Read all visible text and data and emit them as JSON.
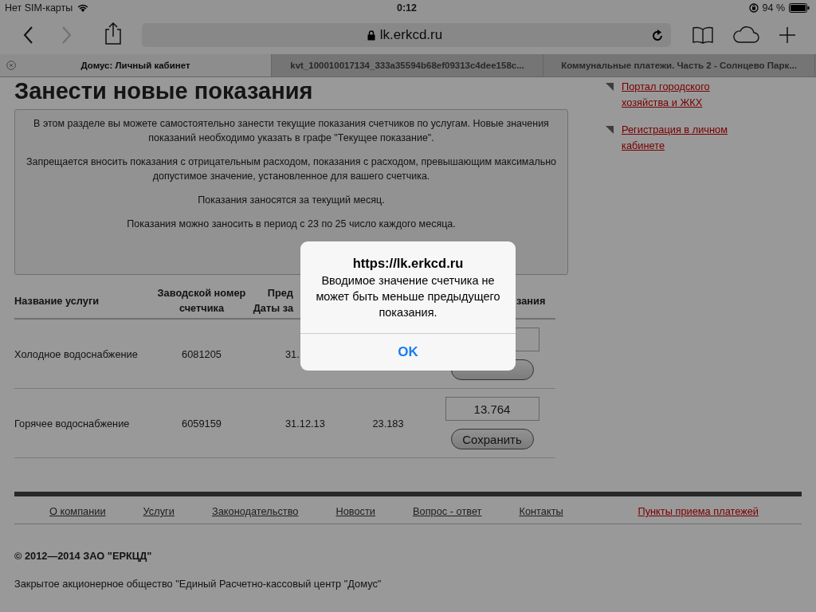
{
  "status_bar": {
    "carrier": "Нет SIM-карты",
    "time": "0:12",
    "battery": "94 %"
  },
  "toolbar": {
    "back": {
      "disabled": false
    },
    "forward": {
      "disabled": true
    },
    "address": "lk.erkcd.ru"
  },
  "tabs": [
    {
      "label": "Домус: Личный кабинет",
      "selected": true
    },
    {
      "label": "kvt_100010017134_333a35594b68ef09313c4dee158c...",
      "selected": false
    },
    {
      "label": "Коммунальные платежи. Часть 2 - Солнцево Парк...",
      "selected": false
    }
  ],
  "page": {
    "heading": "Занести новые показания",
    "notice": [
      "В этом разделе вы можете самостоятельно занести текущие показания счетчиков по услугам. Новые значения показаний необходимо указать в графе \"Текущее показание\".",
      "Запрещается вносить показания с отрицательным расходом, показания с расходом, превышающим максимально допустимое значение, установленное для вашего счетчика.",
      "Показания заносятся за текущий месяц.",
      "Показания можно заносить в период с 23 по 25 число каждого месяца."
    ],
    "table": {
      "header": {
        "column_1": [
          "Название услуги"
        ],
        "column_2": [
          "Заводской номер",
          "счетчика"
        ],
        "column_3": [
          "Пред",
          "Даты за"
        ],
        "column_5": [
          "зания"
        ]
      },
      "rows": [
        {
          "service": "Холодное водоснабжение",
          "serial": "6081205",
          "date": "31."
        },
        {
          "service": "Горячее водоснабжение",
          "serial": "6059159",
          "date": "31.12.13",
          "previous": "23.183",
          "current": "13.764",
          "save": "Сохранить"
        }
      ]
    },
    "sidebar_links": [
      "Портал городского хозяйства и ЖКХ",
      "Регистрация в личном кабинете"
    ],
    "footer": {
      "links": [
        {
          "label": "О компании",
          "kind": "plain"
        },
        {
          "label": "Услуги",
          "kind": "plain"
        },
        {
          "label": "Законодательство",
          "kind": "plain"
        },
        {
          "label": "Новости",
          "kind": "plain"
        },
        {
          "label": "Вопрос - ответ",
          "kind": "plain"
        },
        {
          "label": "Контакты",
          "kind": "plain"
        },
        {
          "label": "Пункты приема платежей",
          "kind": "accent"
        }
      ],
      "copyright": "© 2012—2014 ЗАО \"ЕРКЦД\"",
      "company": "Закрытое акционерное общество \"Единый Расчетно-кассовый центр \"Домус\""
    }
  },
  "dialog": {
    "title": "https://lk.erkcd.ru",
    "message": "Вводимое значение счетчика не может быть меньше предыдущего показания.",
    "button": "OK"
  }
}
